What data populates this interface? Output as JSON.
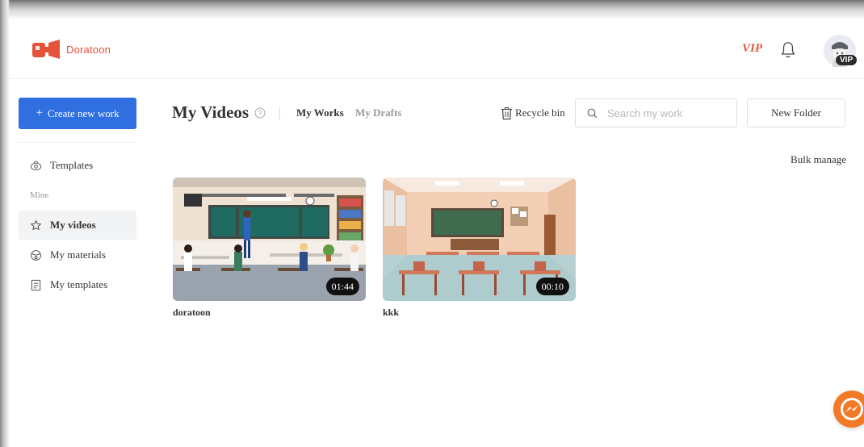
{
  "brand": {
    "name": "Doratoon",
    "accent": "#e5533a",
    "primary": "#2f6fe0"
  },
  "header": {
    "vip_label": "VIP",
    "bell_icon": "bell-icon",
    "avatar_badge": "VIP"
  },
  "sidebar": {
    "create_label": "Create new work",
    "create_icon": "+",
    "templates_label": "Templates",
    "section_label": "Mine",
    "items": [
      {
        "label": "My videos",
        "icon": "star-icon",
        "active": true
      },
      {
        "label": "My materials",
        "icon": "materials-icon",
        "active": false
      },
      {
        "label": "My templates",
        "icon": "template-icon",
        "active": false
      }
    ]
  },
  "main": {
    "title": "My Videos",
    "tabs": [
      {
        "label": "My Works",
        "active": true
      },
      {
        "label": "My Drafts",
        "active": false
      }
    ],
    "recycle_label": "Recycle bin",
    "search_placeholder": "Search my work",
    "new_folder_label": "New Folder",
    "bulk_manage_label": "Bulk manage",
    "videos": [
      {
        "title": "doratoon",
        "duration": "01:44"
      },
      {
        "title": "kkk",
        "duration": "00:10"
      }
    ]
  }
}
